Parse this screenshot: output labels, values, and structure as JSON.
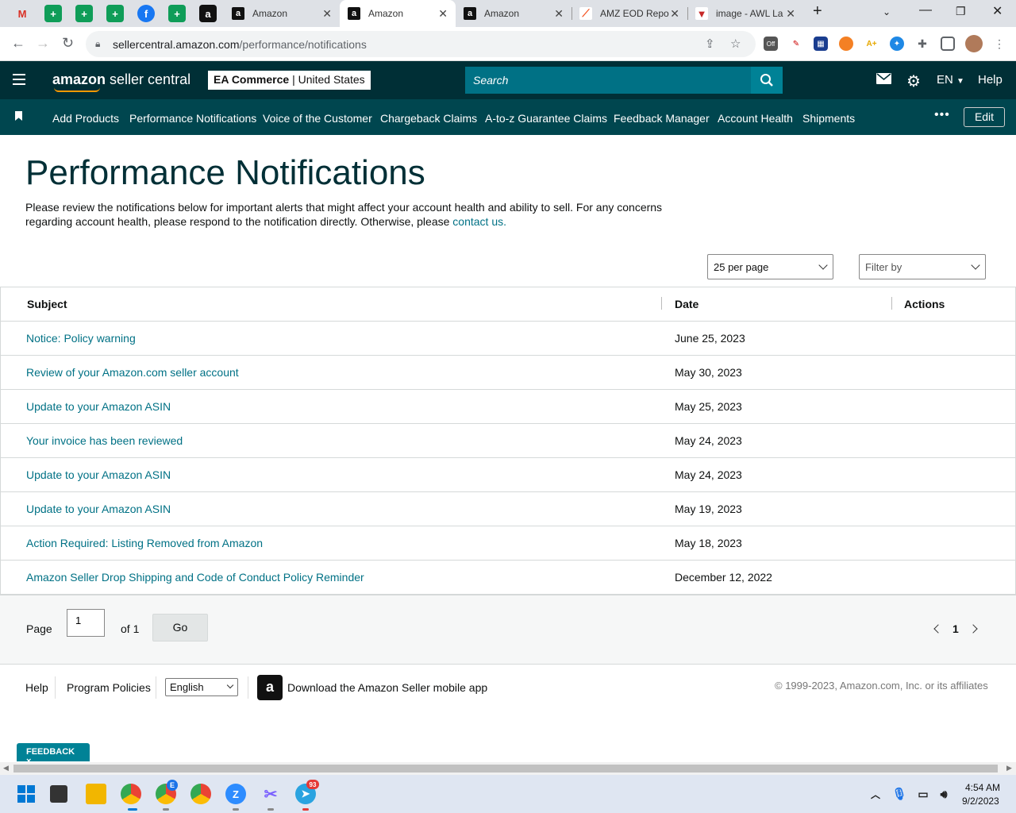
{
  "browser": {
    "tabs": [
      {
        "title": "Amazon",
        "active": false
      },
      {
        "title": "Amazon",
        "active": true
      },
      {
        "title": "Amazon",
        "active": false
      },
      {
        "title": "AMZ EOD Repo",
        "active": false
      },
      {
        "title": "image - AWL La",
        "active": false
      }
    ],
    "url_host": "sellercentral.amazon.com",
    "url_path": "/performance/notifications",
    "ext_off_badge": "Off"
  },
  "header": {
    "logo_bold": "amazon",
    "logo_rest": " seller central",
    "store_name": "EA Commerce",
    "store_sep": " | ",
    "store_region": "United States",
    "search_placeholder": "Search",
    "language": "EN",
    "help": "Help"
  },
  "nav": {
    "items": [
      "Add Products",
      "Performance Notifications",
      "Voice of the Customer",
      "Chargeback Claims",
      "A-to-z Guarantee Claims",
      "Feedback Manager",
      "Account Health",
      "Shipments"
    ],
    "more": "•••",
    "edit": "Edit"
  },
  "page": {
    "title": "Performance Notifications",
    "description": "Please review the notifications below for important alerts that might affect your account health and ability to sell. For any concerns regarding account health, please respond to the notification directly. Otherwise, please ",
    "contact_link": "contact us.",
    "per_page": "25 per page",
    "filter_placeholder": "Filter by"
  },
  "table": {
    "headers": {
      "subject": "Subject",
      "date": "Date",
      "actions": "Actions"
    },
    "rows": [
      {
        "subject": "Notice: Policy warning",
        "date": "June 25, 2023"
      },
      {
        "subject": "Review of your Amazon.com seller account",
        "date": "May 30, 2023"
      },
      {
        "subject": "Update to your Amazon ASIN",
        "date": "May 25, 2023"
      },
      {
        "subject": "Your invoice has been reviewed",
        "date": "May 24, 2023"
      },
      {
        "subject": "Update to your Amazon ASIN",
        "date": "May 24, 2023"
      },
      {
        "subject": "Update to your Amazon ASIN",
        "date": "May 19, 2023"
      },
      {
        "subject": "Action Required: Listing Removed from Amazon",
        "date": "May 18, 2023"
      },
      {
        "subject": "Amazon Seller Drop Shipping and Code of Conduct Policy Reminder",
        "date": "December 12, 2022"
      }
    ]
  },
  "pager": {
    "page_label": "Page",
    "page_value": "1",
    "of_label": "of 1",
    "go": "Go",
    "current": "1"
  },
  "footer": {
    "help": "Help",
    "policies": "Program Policies",
    "language": "English",
    "app_text": "Download the Amazon Seller mobile app",
    "copyright": "© 1999-2023, Amazon.com, Inc. or its affiliates"
  },
  "feedback": "FEEDBACK ×",
  "taskbar": {
    "time": "4:54 AM",
    "date": "9/2/2023",
    "telegram_badge": "93",
    "chrome_profile_badge": "E"
  },
  "colors": {
    "header_bg": "#002f36",
    "nav_bg": "#00464f",
    "link": "#007185",
    "search_bg": "#007185",
    "accent_orange": "#ff9900"
  }
}
